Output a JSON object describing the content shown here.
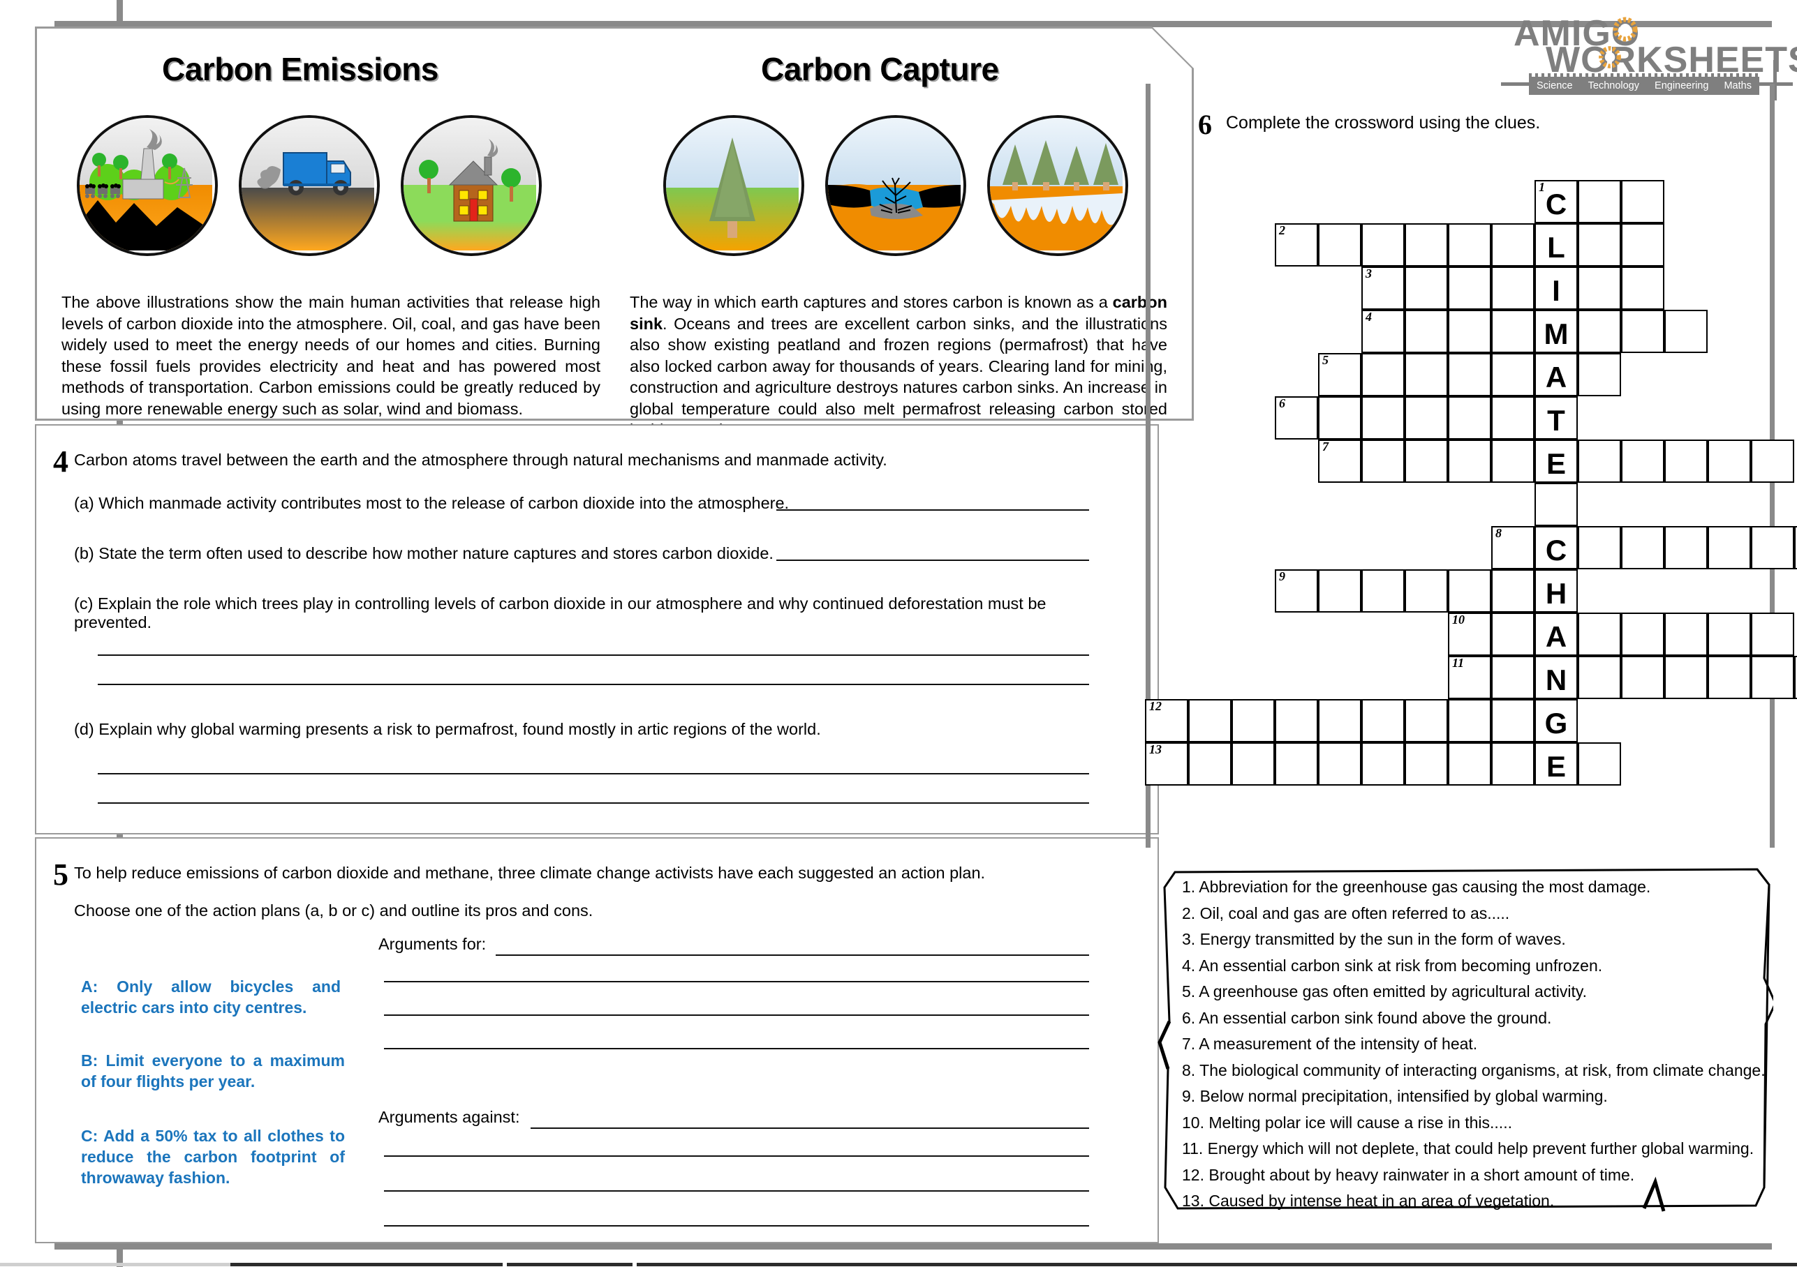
{
  "brand": {
    "line1": "AMIGO",
    "line2": "WORKSHEETS",
    "tagline_items": [
      "Science",
      "Technology",
      "Engineering",
      "Maths"
    ],
    "color": "#7f7f7f",
    "accent": "#e8a33d"
  },
  "panels": {
    "emissions": {
      "title": "Carbon Emissions",
      "illustrations": [
        "coal-mine-factory-illustration",
        "diesel-truck-illustration",
        "house-chimney-illustration"
      ],
      "paragraph": "The above illustrations show the main human activities that release high levels of carbon dioxide into the atmosphere. Oil, coal, and gas have been widely used to meet the energy needs of our homes and cities. Burning these fossil fuels provides electricity and heat and has powered most methods of transportation. Carbon emissions could be greatly reduced by using more renewable energy such as solar, wind and biomass."
    },
    "capture": {
      "title": "Carbon Capture",
      "illustrations": [
        "single-tree-illustration",
        "ocean-peatland-illustration",
        "permafrost-forest-illustration"
      ],
      "paragraph_part1": "The way in which earth captures and stores carbon is known as a ",
      "paragraph_bold": "carbon sink",
      "paragraph_part2": ". Oceans and trees are excellent carbon sinks, and the illustrations also show existing peatland and frozen regions (permafrost) that have also locked carbon away for thousands of years. Clearing land for mining, construction and agriculture destroys natures carbon sinks. An increase in global temperature could also melt permafrost releasing carbon stored inside organic matter."
    }
  },
  "question4": {
    "number": "4",
    "stem": "Carbon atoms travel between the earth and the atmosphere through natural mechanisms and manmade activity.",
    "parts": [
      {
        "label": "(a)",
        "text": "Which manmade activity contributes most to the release of carbon dioxide into the atmosphere."
      },
      {
        "label": "(b)",
        "text": "State the term often used to describe how mother nature captures and stores carbon dioxide."
      },
      {
        "label": "(c)",
        "text": "Explain the role which trees play in controlling levels of carbon dioxide in our atmosphere and why continued deforestation must be prevented."
      },
      {
        "label": "(d)",
        "text": "Explain why global warming presents a risk to permafrost, found mostly in artic regions of the world."
      }
    ]
  },
  "question5": {
    "number": "5",
    "stem": "To help reduce emissions of carbon dioxide and methane, three climate change activists have each suggested an action plan.",
    "instruction": "Choose one of the action plans (a, b or c) and outline its pros and cons.",
    "plans": [
      {
        "id": "A",
        "text": "A: Only allow bicycles and electric cars into city centres."
      },
      {
        "id": "B",
        "text": "B: Limit everyone to a maximum of four flights per year."
      },
      {
        "id": "C",
        "text": "C: Add a 50% tax to all clothes to reduce the carbon footprint of throwaway fashion."
      }
    ],
    "plan_color": "#1b75bc",
    "arguments_for_label": "Arguments for:",
    "arguments_against_label": "Arguments against:"
  },
  "question6": {
    "number": "6",
    "instruction": "Complete the crossword using the clues.",
    "spine_word": "CLIMATECHANGE",
    "clues": [
      "1. Abbreviation for the greenhouse gas causing the most damage.",
      "2. Oil, coal and gas are often referred to as.....",
      "3. Energy transmitted by the sun in the form of waves.",
      "4. An essential carbon sink at risk from becoming unfrozen.",
      "5. A greenhouse gas often emitted by agricultural activity.",
      "6. An essential carbon sink found above the ground.",
      "7. A measurement of the intensity of heat.",
      "8. The biological community of interacting organisms, at risk, from climate change.",
      "9. Below normal precipitation, intensified by global warming.",
      "10. Melting polar ice will cause a rise in this.....",
      "11. Energy which will not deplete, that could help prevent further global warming.",
      "12. Brought about by heavy rainwater in a short amount of time.",
      "13. Caused by intense heat in an area of vegetation."
    ],
    "grid": {
      "cell": 62,
      "spine_col": 6,
      "rows": [
        {
          "num": "1",
          "row": 0,
          "start": 6,
          "len": 3,
          "letter": "C"
        },
        {
          "num": "2",
          "row": 1,
          "start": 0,
          "len": 9,
          "letter": "L"
        },
        {
          "num": "3",
          "row": 2,
          "start": 2,
          "len": 7,
          "letter": "I"
        },
        {
          "num": "4",
          "row": 3,
          "start": 2,
          "len": 8,
          "letter": "M"
        },
        {
          "num": "5",
          "row": 4,
          "start": 1,
          "len": 7,
          "letter": "A"
        },
        {
          "num": "6",
          "row": 5,
          "start": 0,
          "len": 7,
          "letter": "T"
        },
        {
          "num": "7",
          "row": 6,
          "start": 1,
          "len": 11,
          "letter": "E"
        },
        {
          "num": "8",
          "row": 8,
          "start": 5,
          "len": 10,
          "letter": "C"
        },
        {
          "num": "9",
          "row": 9,
          "start": 0,
          "len": 7,
          "letter": "H"
        },
        {
          "num": "10",
          "row": 10,
          "start": 4,
          "len": 8,
          "letter": "A"
        },
        {
          "num": "11",
          "row": 11,
          "start": 4,
          "len": 9,
          "letter": "N"
        },
        {
          "num": "12",
          "row": 12,
          "start": -3,
          "len": 10,
          "letter": "G"
        },
        {
          "num": "13",
          "row": 13,
          "start": -3,
          "len": 11,
          "letter": "E"
        }
      ],
      "spine_filler_rows": [
        7
      ]
    }
  }
}
